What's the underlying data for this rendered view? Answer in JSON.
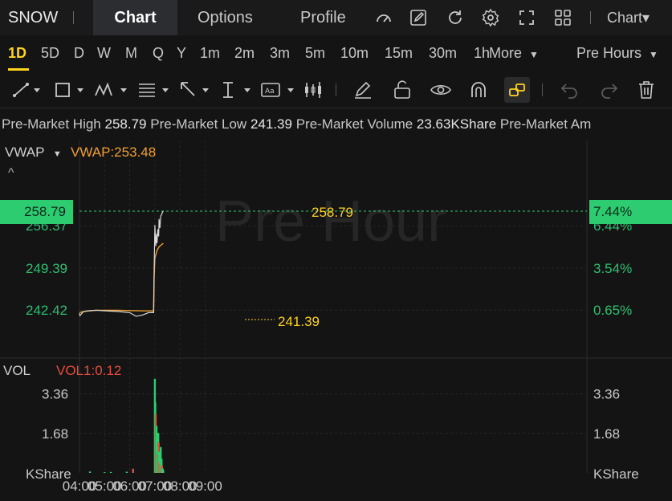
{
  "header": {
    "symbol": "SNOW",
    "tabs": [
      "Chart",
      "Options",
      "Profile"
    ],
    "chart_menu": "Chart▾",
    "icons": [
      "indicator-icon",
      "edit-icon",
      "refresh-icon",
      "settings-icon",
      "fullscreen-icon",
      "layout-icon"
    ]
  },
  "timeframes": {
    "items": [
      "1D",
      "5D",
      "D",
      "W",
      "M",
      "Q",
      "Y",
      "1m",
      "2m",
      "3m",
      "5m",
      "10m",
      "15m",
      "30m",
      "1h"
    ],
    "selected": "1D",
    "more_label": "More",
    "session_label": "Pre Hours"
  },
  "info": {
    "high_label": "Pre-Market High",
    "high_value": "258.79",
    "low_label": "Pre-Market Low",
    "low_value": "241.39",
    "volume_label": "Pre-Market Volume",
    "volume_value": "23.63KShare",
    "amount_label": "Pre-Market Am"
  },
  "price_panel": {
    "indicator": "VWAP",
    "vwap_label": "VWAP:253.48",
    "watermark": "Pre Hour",
    "last_price_badge": "258.79",
    "last_pct_badge": "7.44%",
    "high_annotation": "258.79",
    "low_annotation": "241.39",
    "left_ticks": [
      "256.37",
      "249.39",
      "242.42"
    ],
    "right_ticks": [
      "6.44%",
      "3.54%",
      "0.65%"
    ]
  },
  "volume_panel": {
    "indicator": "VOL",
    "vol_label": "VOL1:0.12",
    "left_ticks": [
      "3.36",
      "1.68",
      "KShare"
    ],
    "right_ticks": [
      "3.36",
      "1.68",
      "KShare"
    ]
  },
  "x_ticks": [
    "04:00",
    "05:00",
    "06:00",
    "07:00",
    "08:00",
    "09:00"
  ],
  "colors": {
    "accent": "#ffd21f",
    "up": "#2ecc71",
    "down": "#e74c3c",
    "vwap": "#f0a030",
    "price_line": "#d8d8d8"
  },
  "chart_data": {
    "type": "line",
    "x_range": [
      "04:00",
      "09:00"
    ],
    "y_range": [
      239.5,
      260.5
    ],
    "price": {
      "x": [
        "04:00",
        "04:01",
        "04:10",
        "04:20",
        "04:40",
        "05:00",
        "05:30",
        "06:00",
        "06:15",
        "06:30",
        "06:45",
        "06:57",
        "06:58",
        "07:00",
        "07:02",
        "07:04",
        "07:05",
        "07:07",
        "07:09",
        "07:10",
        "07:12",
        "07:14",
        "07:16",
        "07:18",
        "07:20"
      ],
      "y": [
        241.9,
        241.5,
        242.2,
        242.3,
        242.4,
        242.3,
        242.2,
        242.0,
        241.4,
        241.6,
        242.0,
        242.0,
        248.0,
        256.5,
        253.0,
        255.0,
        253.5,
        255.8,
        254.6,
        257.5,
        256.0,
        258.0,
        258.2,
        258.6,
        258.79
      ]
    },
    "vwap": {
      "x": [
        "04:00",
        "04:10",
        "04:40",
        "05:30",
        "06:30",
        "06:57",
        "06:58",
        "07:00",
        "07:05",
        "07:10",
        "07:20"
      ],
      "y": [
        242.0,
        242.2,
        242.4,
        242.4,
        242.3,
        242.3,
        247.5,
        251.0,
        252.3,
        252.9,
        253.48
      ]
    },
    "volume": {
      "x": [
        "04:25",
        "05:00",
        "05:15",
        "05:53",
        "06:08",
        "07:00",
        "07:01",
        "07:02",
        "07:03",
        "07:04",
        "07:05",
        "07:06",
        "07:07",
        "07:08",
        "07:09",
        "07:10",
        "07:11",
        "07:12",
        "07:13",
        "07:14",
        "07:15",
        "07:16",
        "07:17",
        "07:18",
        "07:19",
        "07:20"
      ],
      "y": [
        0.06,
        0.03,
        0.04,
        0.05,
        0.18,
        4.0,
        3.0,
        2.5,
        1.5,
        2.0,
        1.2,
        0.8,
        0.6,
        1.7,
        1.3,
        0.9,
        0.5,
        0.7,
        0.4,
        1.1,
        0.35,
        0.6,
        0.3,
        0.2,
        0.15,
        0.12
      ],
      "up": [
        true,
        true,
        true,
        true,
        false,
        true,
        true,
        false,
        false,
        true,
        true,
        false,
        true,
        true,
        false,
        true,
        false,
        true,
        false,
        true,
        false,
        true,
        false,
        true,
        true,
        true
      ]
    },
    "vol_range": [
      0,
      4.2
    ]
  }
}
